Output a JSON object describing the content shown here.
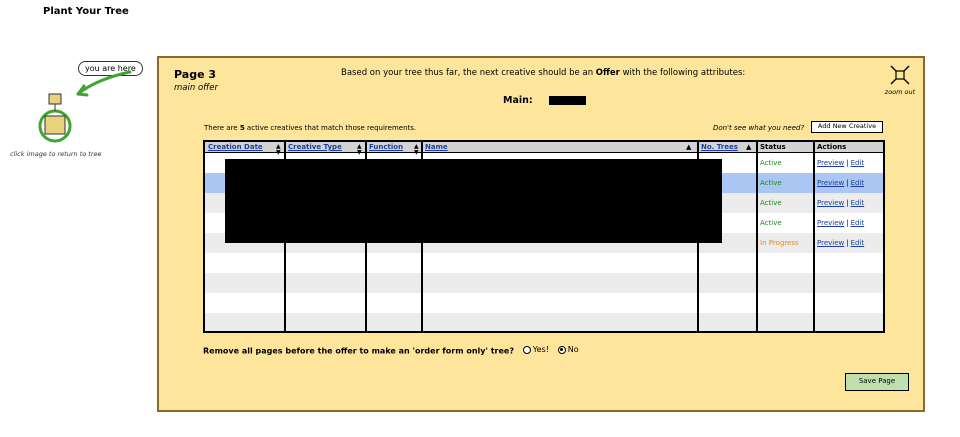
{
  "app": {
    "title": "Plant Your Tree"
  },
  "tree": {
    "you_are_here": "you are here",
    "caption": "click image to return to tree"
  },
  "panel": {
    "page_label": "Page 3",
    "page_sub": "main offer",
    "instruction_prefix": "Based on your tree thus far, the next creative should be an ",
    "instruction_bold": "Offer",
    "instruction_suffix": " with the following attributes:",
    "main_label": "Main:",
    "zoom_label": "zoom out"
  },
  "summary": {
    "prefix": "There are ",
    "count": "5",
    "suffix": " active creatives that match those requirements.",
    "need_text": "Don't see what you need?",
    "add_button": "Add New Creative"
  },
  "table": {
    "headers": {
      "creation_date": "Creation Date",
      "creative_type": "Creative Type",
      "function": "Function",
      "name": "Name",
      "no_trees": "No. Trees",
      "status": "Status",
      "actions": "Actions"
    },
    "rows": [
      {
        "status": "Active",
        "preview": "Preview",
        "sep": "|",
        "edit": "Edit"
      },
      {
        "status": "Active",
        "preview": "Preview",
        "sep": "|",
        "edit": "Edit"
      },
      {
        "status": "Active",
        "preview": "Preview",
        "sep": "|",
        "edit": "Edit"
      },
      {
        "status": "Active",
        "preview": "Preview",
        "sep": "|",
        "edit": "Edit"
      },
      {
        "status": "In Progress",
        "preview": "Preview",
        "sep": "|",
        "edit": "Edit"
      }
    ]
  },
  "remove": {
    "question": "Remove all pages before the offer to make an 'order form only' tree?",
    "yes": "Yes!",
    "no": "No",
    "selected": "no"
  },
  "save_button": "Save Page",
  "colors": {
    "panel_bg": "#fde59c",
    "selected_row": "#a9c7f2",
    "active": "#1f8a1f",
    "in_progress": "#e38a1a",
    "link": "#1b3f9e",
    "save_bg": "#bfe0ac"
  }
}
